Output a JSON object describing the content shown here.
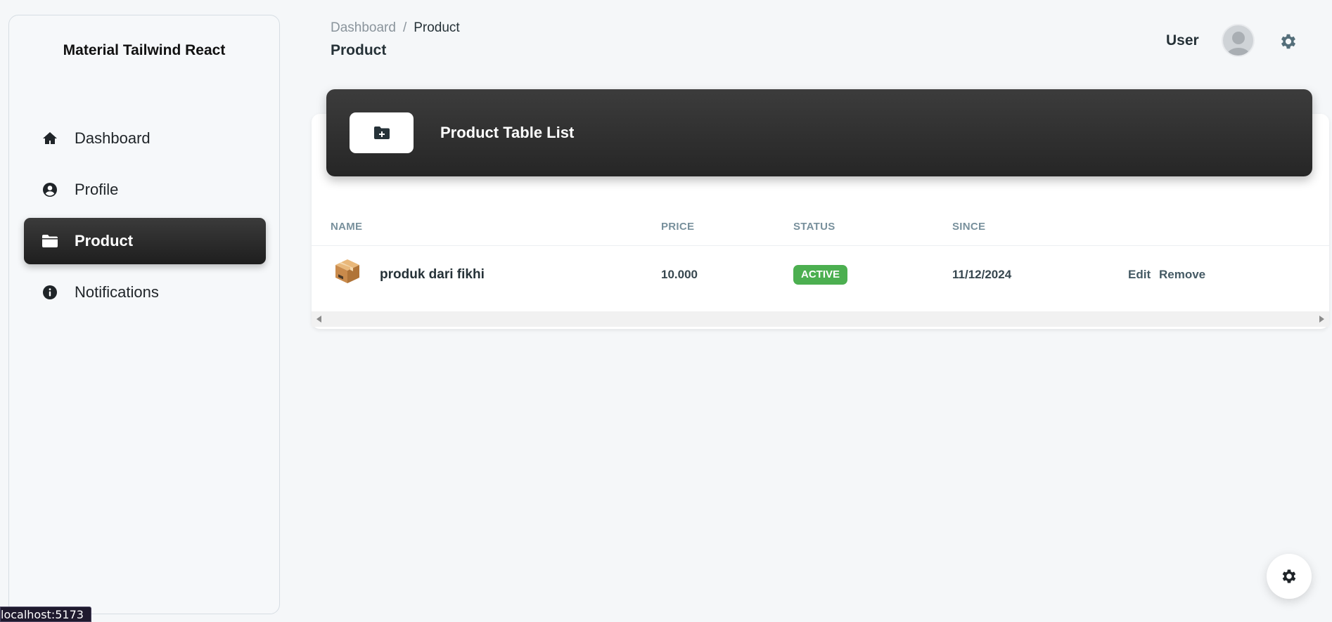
{
  "sidebar": {
    "brand": "Material Tailwind React",
    "items": [
      {
        "label": "Dashboard",
        "icon": "home-icon",
        "active": false
      },
      {
        "label": "Profile",
        "icon": "user-circle-icon",
        "active": false
      },
      {
        "label": "Product",
        "icon": "folder-icon",
        "active": true
      },
      {
        "label": "Notifications",
        "icon": "info-circle-icon",
        "active": false
      }
    ]
  },
  "header": {
    "breadcrumb": [
      "Dashboard",
      "Product"
    ],
    "breadcrumb_separator": "/",
    "title": "Product",
    "user_label": "User"
  },
  "card": {
    "title": "Product Table List",
    "icon": "folder-plus-icon",
    "columns": [
      "NAME",
      "PRICE",
      "STATUS",
      "SINCE"
    ],
    "rows": [
      {
        "name": "produk dari fikhi",
        "price": "10.000",
        "status": "ACTIVE",
        "since": "11/12/2024",
        "actions": [
          "Edit",
          "Remove"
        ]
      }
    ]
  },
  "status_bar_url": "localhost:5173",
  "colors": {
    "status_active": "#4caf50",
    "dark_gradient_top": "#3c3c3c",
    "dark_gradient_bottom": "#262626"
  }
}
